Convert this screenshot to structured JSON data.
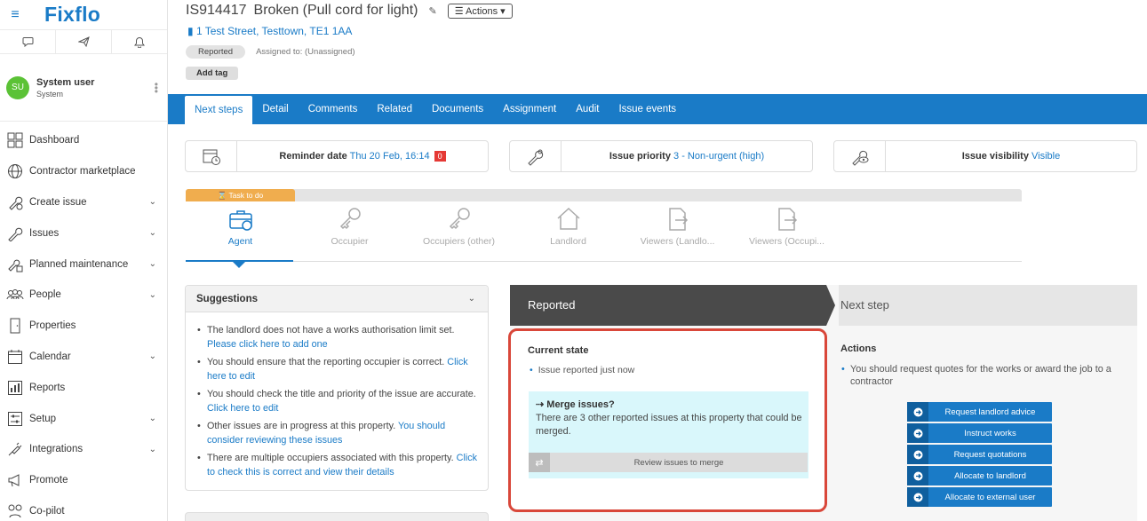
{
  "app": {
    "logo": "Fixflo"
  },
  "user": {
    "initials": "SU",
    "name": "System user",
    "role": "System"
  },
  "nav": [
    {
      "label": "Dashboard",
      "icon": "dashboard-icon",
      "chevron": false
    },
    {
      "label": "Contractor marketplace",
      "icon": "globe-icon",
      "chevron": false
    },
    {
      "label": "Create issue",
      "icon": "wrench-plus-icon",
      "chevron": true
    },
    {
      "label": "Issues",
      "icon": "wrench-icon",
      "chevron": true
    },
    {
      "label": "Planned maintenance",
      "icon": "calendar-wrench-icon",
      "chevron": true
    },
    {
      "label": "People",
      "icon": "people-icon",
      "chevron": true
    },
    {
      "label": "Properties",
      "icon": "door-icon",
      "chevron": false
    },
    {
      "label": "Calendar",
      "icon": "calendar-icon",
      "chevron": true
    },
    {
      "label": "Reports",
      "icon": "bar-chart-icon",
      "chevron": false
    },
    {
      "label": "Setup",
      "icon": "sliders-icon",
      "chevron": true
    },
    {
      "label": "Integrations",
      "icon": "plug-icon",
      "chevron": true
    },
    {
      "label": "Promote",
      "icon": "megaphone-icon",
      "chevron": false
    },
    {
      "label": "Co-pilot",
      "icon": "copilot-icon",
      "chevron": false
    }
  ],
  "header": {
    "issue_id": "IS914417",
    "issue_title": "Broken (Pull cord for light)",
    "actions_label": "Actions",
    "address": "1 Test Street, Testtown, TE1 1AA",
    "status": "Reported",
    "assigned": "Assigned to: (Unassigned)",
    "add_tag": "Add tag"
  },
  "tabs": [
    "Next steps",
    "Detail",
    "Comments",
    "Related",
    "Documents",
    "Assignment",
    "Audit",
    "Issue events"
  ],
  "info": {
    "reminder_label": "Reminder date",
    "reminder_value": "Thu 20 Feb, 16:14",
    "reminder_badge": "0",
    "priority_label": "Issue priority",
    "priority_value": "3 - Non-urgent (high)",
    "visibility_label": "Issue visibility",
    "visibility_value": "Visible"
  },
  "task": {
    "tag": "Task to do",
    "roles": [
      "Agent",
      "Occupier",
      "Occupiers (other)",
      "Landlord",
      "Viewers (Landlo...",
      "Viewers (Occupi..."
    ]
  },
  "suggestions": {
    "title": "Suggestions",
    "items": [
      {
        "text": "The landlord does not have a works authorisation limit set. ",
        "link": "Please click here to add one"
      },
      {
        "text": "You should ensure that the reporting occupier is correct. ",
        "link": "Click here to edit"
      },
      {
        "text": "You should check the title and priority of the issue are accurate. ",
        "link": "Click here to edit"
      },
      {
        "text": "Other issues are in progress at this property. ",
        "link": "You should consider reviewing these issues"
      },
      {
        "text": "There are multiple occupiers associated with this property. ",
        "link": "Click to check this is correct and view their details"
      }
    ]
  },
  "workflow": {
    "current_stage": "Reported",
    "next_stage": "Next step",
    "current_state_title": "Current state",
    "current_state_item": "Issue reported just now",
    "merge_title": "Merge issues?",
    "merge_text": "There are 3 other reported issues at this property that could be merged.",
    "merge_button": "Review issues to merge",
    "actions_title": "Actions",
    "actions_text": "You should request quotes for the works or award the job to a contractor",
    "action_buttons": [
      "Request landlord advice",
      "Instruct works",
      "Request quotations",
      "Allocate to landlord",
      "Allocate to external user"
    ]
  },
  "colors": {
    "brand": "#1a7bc7",
    "alert": "#e53935",
    "task": "#f0ad4e",
    "highlight": "#d9473a"
  }
}
